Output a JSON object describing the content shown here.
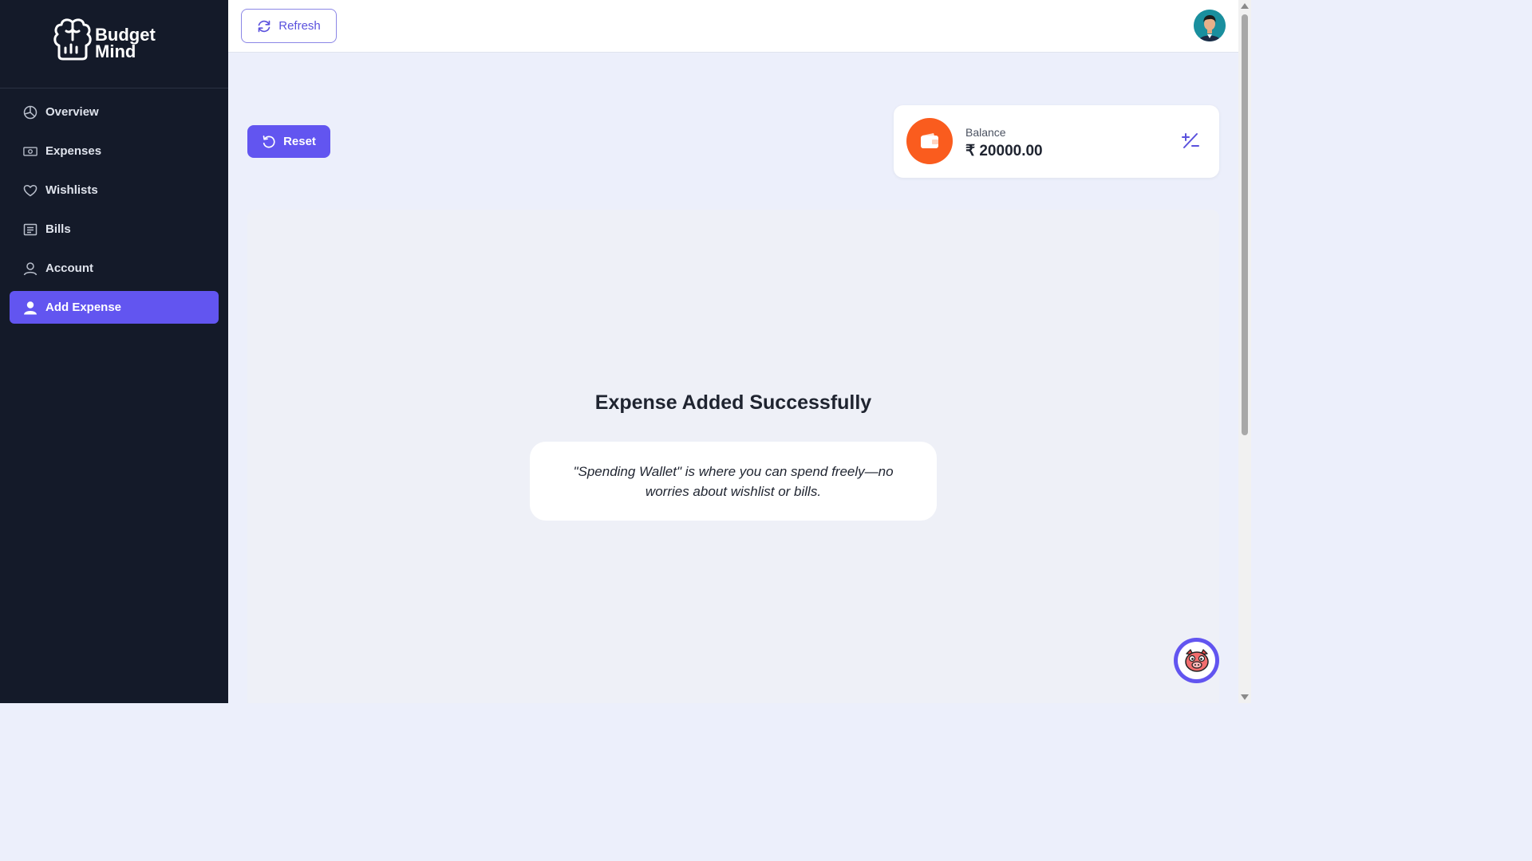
{
  "brand": {
    "line1": "Budget",
    "line2": "Mind"
  },
  "sidebar": {
    "items": [
      {
        "label": "Overview",
        "icon": "pie-chart-icon"
      },
      {
        "label": "Expenses",
        "icon": "banknote-icon"
      },
      {
        "label": "Wishlists",
        "icon": "heart-icon"
      },
      {
        "label": "Bills",
        "icon": "receipt-icon"
      },
      {
        "label": "Account",
        "icon": "user-icon"
      },
      {
        "label": "Add Expense",
        "icon": "user-filled-icon",
        "active": true
      }
    ]
  },
  "topbar": {
    "refresh_label": "Refresh"
  },
  "main": {
    "reset_label": "Reset",
    "balance": {
      "label": "Balance",
      "value": "₹ 20000.00"
    },
    "success_title": "Expense Added Successfully",
    "quote": "\"Spending Wallet\" is where you can spend freely—no worries about wishlist or bills."
  },
  "colors": {
    "accent": "#6255f0",
    "sidebar_bg": "#141a29",
    "wallet_orange": "#fa5c1e",
    "page_bg": "#eceffb"
  }
}
